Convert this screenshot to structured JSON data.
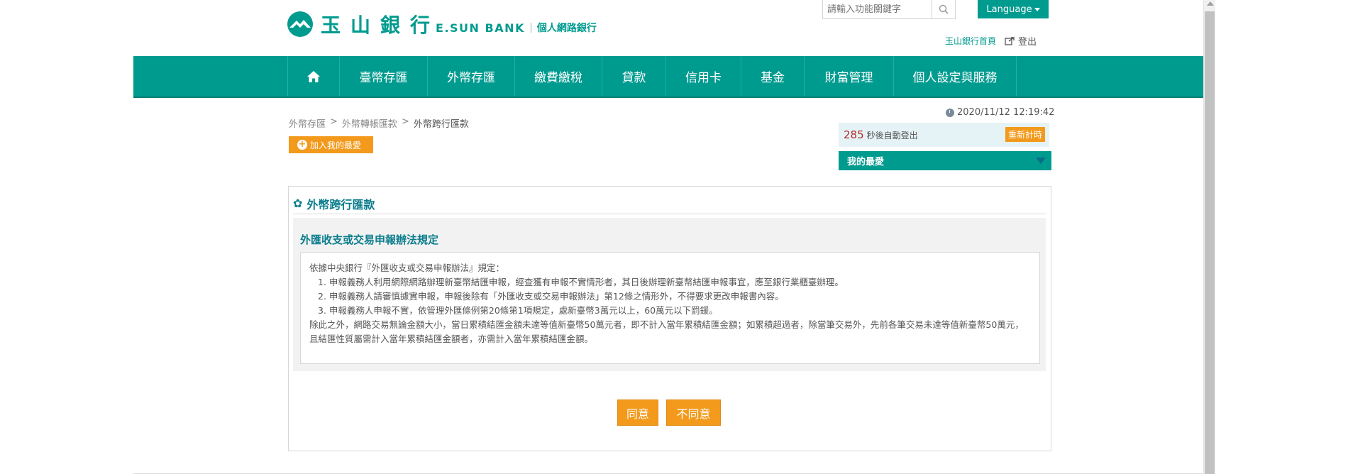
{
  "header": {
    "logo_text": "玉山銀行",
    "logo_en": "E.SUN BANK",
    "logo_sub": "個人網路銀行",
    "search_placeholder": "請輸入功能關鍵字",
    "language_label": "Language",
    "home_link": "玉山銀行首頁",
    "logout_label": "登出"
  },
  "nav": {
    "home_icon": "home-icon",
    "items": [
      {
        "label": "臺幣存匯"
      },
      {
        "label": "外幣存匯"
      },
      {
        "label": "繳費繳稅"
      },
      {
        "label": "貸款"
      },
      {
        "label": "信用卡"
      },
      {
        "label": "基金"
      },
      {
        "label": "財富管理"
      },
      {
        "label": "個人設定與服務"
      }
    ]
  },
  "breadcrumb": {
    "items": [
      "外幣存匯",
      "外幣轉帳匯款",
      "外幣跨行匯款"
    ],
    "separator": ">"
  },
  "favorite_button": "加入我的最愛",
  "session": {
    "datetime": "2020/11/12 12:19:42",
    "seconds": "285",
    "auto_logout_text": "秒後自動登出",
    "reset_label": "重新計時",
    "my_favorites": "我的最愛"
  },
  "main": {
    "title": "外幣跨行匯款",
    "rule_heading": "外匯收支或交易申報辦法規定",
    "rule_intro": "依據中央銀行『外匯收支或交易申報辦法』規定：",
    "rule_items": [
      "1. 申報義務人利用網際網路辦理新臺幣結匯申報，經查獲有申報不實情形者，其日後辦理新臺幣結匯申報事宜，應至銀行業櫃臺辦理。",
      "2. 申報義務人請審慎據實申報，申報後除有「外匯收支或交易申報辦法」第12條之情形外，不得要求更改申報書內容。",
      "3. 申報義務人申報不實，依管理外匯條例第20條第1項規定，處新臺幣3萬元以上，60萬元以下罰鍰。"
    ],
    "rule_footer": "除此之外，網路交易無論金額大小，當日累積結匯金額未達等值新臺幣50萬元者，即不計入當年累積結匯金額；如累積超過者，除當筆交易外，先前各筆交易未達等值新臺幣50萬元，且結匯性質屬需計入當年累積結匯金額者，亦需計入當年累積結匯金額。",
    "agree_label": "同意",
    "disagree_label": "不同意"
  },
  "colors": {
    "brand": "#009b8f",
    "accent": "#f39a1c",
    "title_text": "#0b7d8c"
  }
}
